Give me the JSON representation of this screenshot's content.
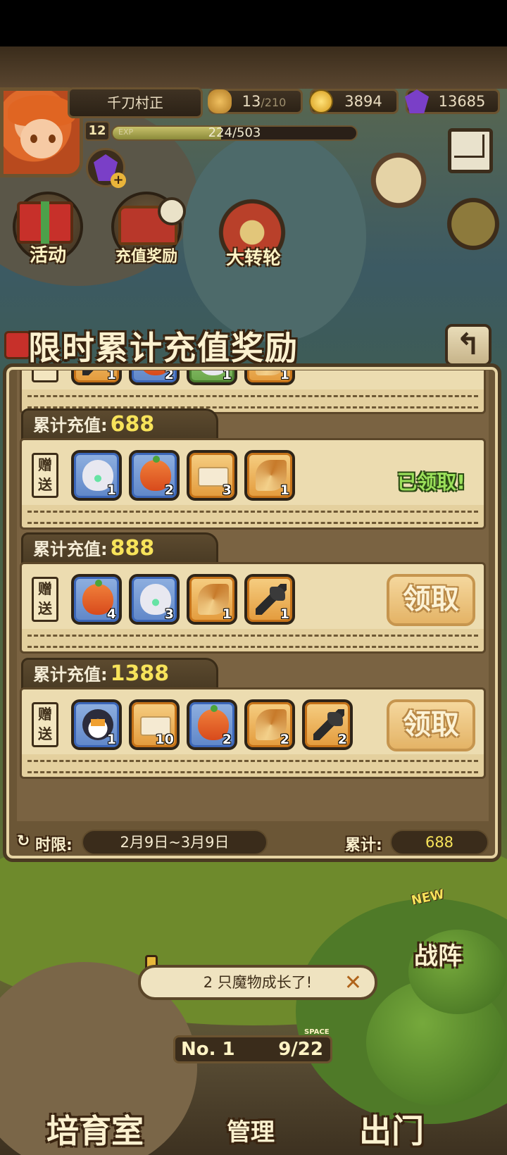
{
  "player": {
    "name": "千刀村正",
    "level": "12",
    "exp_label": "EXP",
    "exp_text": "224/503",
    "exp_fraction": 0.445
  },
  "resources": {
    "stamina_current": "13",
    "stamina_max": "/210",
    "gold": "3894",
    "gems": "13685"
  },
  "scene_buttons": {
    "activity": "活动",
    "recharge_reward": "充值奖励",
    "big_wheel": "大转轮"
  },
  "panel": {
    "title": "限时累计充值奖励",
    "back_glyph": "↰",
    "tier_prefix": "累计充值:",
    "gift_label": "赠送",
    "claimed_text": "已领取!",
    "claim_label": "领取",
    "tiers": [
      {
        "amount": "688",
        "status": "claimed",
        "items": [
          {
            "icon": "rainbow-egg-icon",
            "frame": "blue",
            "count": "1"
          },
          {
            "icon": "fruit-icon",
            "frame": "blue",
            "count": "2"
          },
          {
            "icon": "ticket-icon",
            "frame": "orange",
            "count": "3"
          },
          {
            "icon": "horn-icon",
            "frame": "orange",
            "count": "1"
          }
        ]
      },
      {
        "amount": "888",
        "status": "claimable",
        "items": [
          {
            "icon": "fruit-icon",
            "frame": "blue",
            "count": "4"
          },
          {
            "icon": "rainbow-egg-icon",
            "frame": "blue",
            "count": "3"
          },
          {
            "icon": "horn-icon",
            "frame": "orange",
            "count": "1"
          },
          {
            "icon": "axe-icon",
            "frame": "orange",
            "count": "1"
          }
        ]
      },
      {
        "amount": "1388",
        "status": "claimable",
        "items": [
          {
            "icon": "penguin-icon",
            "frame": "blue",
            "count": "1"
          },
          {
            "icon": "ticket-icon",
            "frame": "orange",
            "count": "10"
          },
          {
            "icon": "fruit-icon",
            "frame": "blue",
            "count": "2"
          },
          {
            "icon": "horn-icon",
            "frame": "orange",
            "count": "2"
          },
          {
            "icon": "axe-icon",
            "frame": "orange",
            "count": "2"
          }
        ]
      }
    ],
    "previous_tier_partial": {
      "gift_label": "送",
      "items": [
        {
          "icon": "axe-icon",
          "frame": "orange",
          "count": "1"
        },
        {
          "icon": "fruit-icon",
          "frame": "blue",
          "count": "2"
        },
        {
          "icon": "egg-icon",
          "frame": "green",
          "count": "1"
        },
        {
          "icon": "horn-icon",
          "frame": "orange",
          "count": "1"
        }
      ]
    },
    "footer": {
      "time_label": "时限:",
      "time_range": "2月9日~3月9日",
      "total_label": "累计:",
      "total_value": "688"
    }
  },
  "bottom": {
    "notice": "2 只魔物成长了!",
    "rank_no": "No. 1",
    "space_label": "SPACE",
    "space_count": "9/22",
    "nursery": "培育室",
    "manage": "管理",
    "go_out": "出门",
    "battle": "战阵",
    "new_tag": "NEW"
  },
  "colors": {
    "amount_yellow": "#f7e35a",
    "claimed_green": "#9be05a",
    "panel_brown": "#6b5636",
    "parchment": "#ecdcb0"
  }
}
